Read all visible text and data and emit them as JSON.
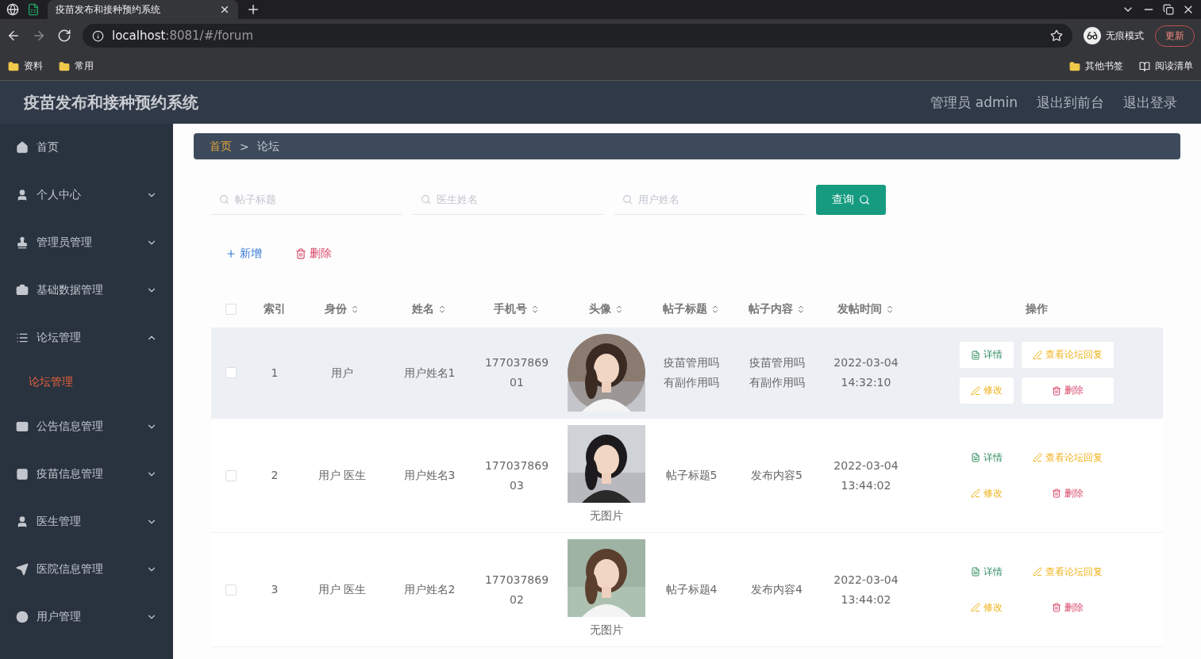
{
  "browser": {
    "tab_title": "疫苗发布和接种预约系统",
    "url_host": "localhost",
    "url_path": ":8081/#/forum",
    "incognito": "无痕模式",
    "update": "更新",
    "bookmarks_left": [
      "资料",
      "常用"
    ],
    "bookmarks_right": [
      "其他书签",
      "阅读清单"
    ]
  },
  "header": {
    "title": "疫苗发布和接种预约系统",
    "links": [
      "管理员 admin",
      "退出到前台",
      "退出登录"
    ]
  },
  "sidebar": {
    "items": [
      {
        "label": "首页",
        "kind": "link"
      },
      {
        "label": "个人中心",
        "kind": "menu",
        "expanded": false
      },
      {
        "label": "管理员管理",
        "kind": "menu",
        "expanded": false
      },
      {
        "label": "基础数据管理",
        "kind": "menu",
        "expanded": false
      },
      {
        "label": "论坛管理",
        "kind": "menu",
        "expanded": true,
        "children": [
          {
            "label": "论坛管理",
            "selected": true
          }
        ]
      },
      {
        "label": "公告信息管理",
        "kind": "menu",
        "expanded": false
      },
      {
        "label": "疫苗信息管理",
        "kind": "menu",
        "expanded": false
      },
      {
        "label": "医生管理",
        "kind": "menu",
        "expanded": false
      },
      {
        "label": "医院信息管理",
        "kind": "menu",
        "expanded": false
      },
      {
        "label": "用户管理",
        "kind": "menu",
        "expanded": false
      }
    ]
  },
  "breadcrumb": {
    "items": [
      "首页",
      "论坛"
    ],
    "separator": ">"
  },
  "search": {
    "fields": [
      {
        "placeholder": "帖子标题"
      },
      {
        "placeholder": "医生姓名"
      },
      {
        "placeholder": "用户姓名"
      }
    ],
    "button": "查询"
  },
  "toolbar": {
    "add": "新增",
    "delete": "删除"
  },
  "table": {
    "columns": [
      {
        "label": "索引",
        "sortable": false
      },
      {
        "label": "身份",
        "sortable": true
      },
      {
        "label": "姓名",
        "sortable": true
      },
      {
        "label": "手机号",
        "sortable": true
      },
      {
        "label": "头像",
        "sortable": true
      },
      {
        "label": "帖子标题",
        "sortable": true
      },
      {
        "label": "帖子内容",
        "sortable": true
      },
      {
        "label": "发帖时间",
        "sortable": true
      },
      {
        "label": "操作",
        "sortable": false
      }
    ],
    "header_checked": false,
    "rows": [
      {
        "checked": false,
        "hovered": true,
        "index": "1",
        "identity": "用户",
        "name": "用户姓名1",
        "phone": "17703786901",
        "title": "疫苗管用吗有副作用吗",
        "content": "疫苗管用吗有副作用吗",
        "time": "2022-03-04 14:32:10",
        "actions": [
          "详情",
          "查看论坛回复",
          "修改",
          "删除"
        ]
      },
      {
        "checked": false,
        "hovered": false,
        "index": "2",
        "identity": "用户 医生",
        "name": "用户姓名3",
        "phone": "17703786903",
        "avatar": {
          "kind": "picture",
          "caption": "无图片"
        },
        "title": "帖子标题5",
        "content": "发布内容5",
        "time": "2022-03-04 13:44:02",
        "actions": [
          "详情",
          "查看论坛回复",
          "修改",
          "删除"
        ]
      },
      {
        "checked": false,
        "hovered": false,
        "index": "3",
        "identity": "用户 医生",
        "name": "用户姓名2",
        "phone": "17703786902",
        "avatar": {
          "kind": "picture",
          "caption": "无图片"
        },
        "title": "帖子标题4",
        "content": "发布内容4",
        "time": "2022-03-04 13:44:02",
        "actions": [
          "详情",
          "查看论坛回复",
          "修改",
          "删除"
        ]
      }
    ]
  }
}
